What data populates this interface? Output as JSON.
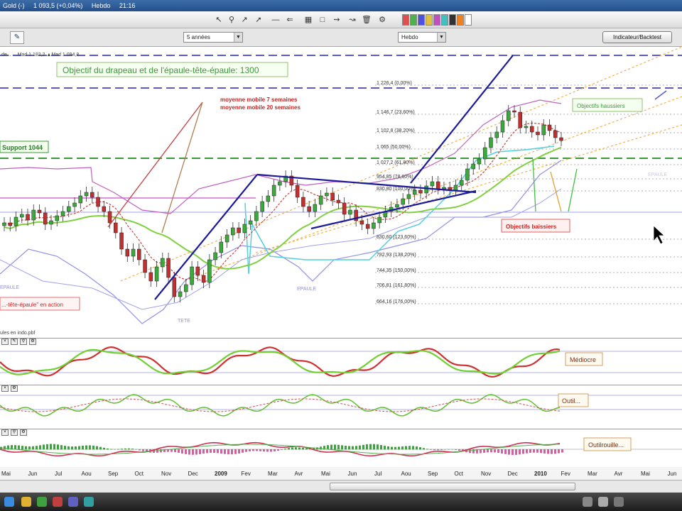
{
  "titlebar": {
    "symbol": "Gold (-)",
    "quote": "1 093,5 (+0,04%)",
    "period": "Hebdo",
    "time": "21:16"
  },
  "periodbar": {
    "range": "5 années",
    "frequency": "Hebdo",
    "indicators_button": "Indicateur/Backtest"
  },
  "main": {
    "legend_fragment": "de... —Mad 1 182,2  ▲Mad 1 094,8",
    "objective_box": "Objectif  du drapeau et de l'épaule-tête-épaule: 1300",
    "support_label": "Support 1044",
    "ma7_label": "moyenne mobile 7 semaines",
    "ma20_label": "moyenne mobile 20 semaines",
    "objectifs_haussiers": "Objectifs haussiers",
    "objectifs_baissiers": "Objectifs baissiers",
    "ete_action": "...-tête-épaule\" en action",
    "label_tete": "TETE",
    "label_epaule": "EPAULE",
    "label_epaule_left": "EPAULE",
    "label_faded": "EPAULE",
    "fib_levels": [
      "1 226,4 (0,00%)",
      "1 146,7 (23,60%)",
      "1 102,8 (38,20%)",
      "1 065 (50,00%)",
      "1 027,2 (61,80%)",
      "954,85 (78,60%)",
      "830,80 (100,00%)",
      "830,60 (123,60%)",
      "782,93 (138,20%)",
      "744,35 (150,00%)",
      "706,81 (161,80%)",
      "664,16 (176,00%)"
    ],
    "footer_note": "ules en indo.pbf"
  },
  "panels": {
    "p1_label": "Médiocre",
    "p2_label": "Outil...",
    "p3_label": "Outilrouille..."
  },
  "xaxis": [
    "Mai",
    "Jun",
    "Jul",
    "Aou",
    "Sep",
    "Oct",
    "Nov",
    "Dec",
    "2009",
    "Fev",
    "Mar",
    "Avr",
    "Mai",
    "Jun",
    "Jul",
    "Aou",
    "Sep",
    "Oct",
    "Nov",
    "Dec",
    "2010",
    "Fev",
    "Mar",
    "Avr",
    "Mai",
    "Jun"
  ],
  "colors": {
    "accent_green": "#3a9a3a",
    "accent_red": "#d02020",
    "trend_blue": "#1a1a9a"
  }
}
